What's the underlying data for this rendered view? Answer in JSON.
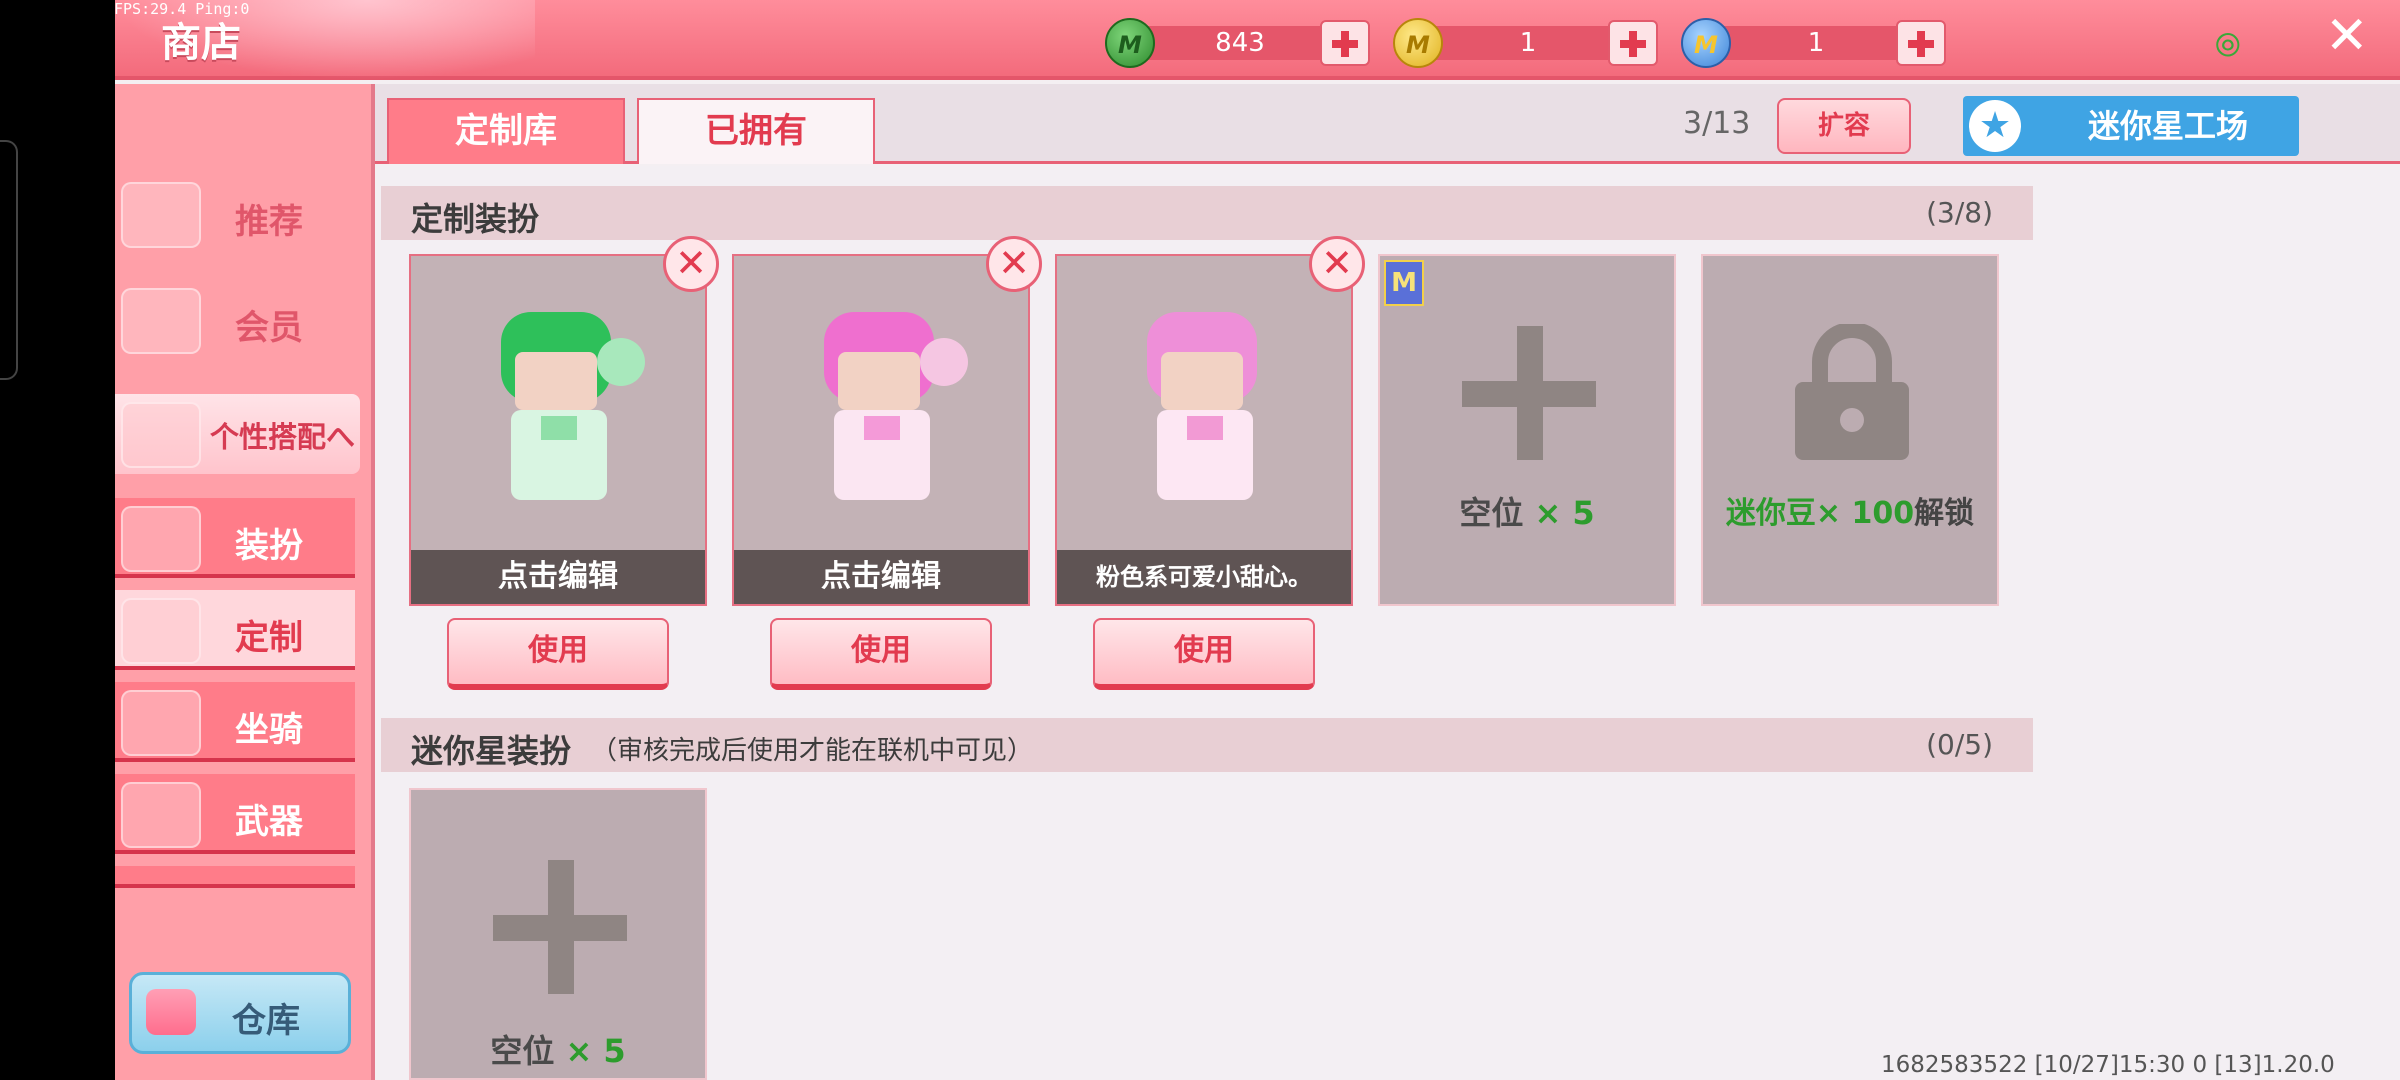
{
  "debug": {
    "fps": "FPS:29.4  Ping:0"
  },
  "header": {
    "title": "商店"
  },
  "currencies": [
    {
      "icon": "green-gem-icon",
      "letter": "M",
      "value": "843",
      "color": "#2e8b2e"
    },
    {
      "icon": "gold-coin-icon",
      "letter": "M",
      "value": "1",
      "color": "#e0b21f"
    },
    {
      "icon": "blue-coin-icon",
      "letter": "M",
      "value": "1",
      "color": "#3d84d8"
    }
  ],
  "nav": {
    "items": [
      {
        "label": "推荐"
      },
      {
        "label": "会员"
      },
      {
        "label": "个性搭配へ"
      },
      {
        "label": "装扮"
      },
      {
        "label": "定制"
      },
      {
        "label": "坐骑"
      },
      {
        "label": "武器"
      }
    ],
    "warehouse": "仓库"
  },
  "tabs": [
    {
      "label": "定制库"
    },
    {
      "label": "已拥有"
    }
  ],
  "capacity": "3/13",
  "expand_label": "扩容",
  "workshop_label": "迷你星工场",
  "section1": {
    "title": "定制装扮",
    "count": "(3/8)"
  },
  "cards": [
    {
      "caption": "点击编辑",
      "use": "使用"
    },
    {
      "caption": "点击编辑",
      "use": "使用"
    },
    {
      "caption": "粉色系可爱小甜心。",
      "use": "使用"
    }
  ],
  "empty_slot": {
    "label": "空位",
    "times": "× 5"
  },
  "locked_slot": {
    "label": "迷你豆",
    "times": "× 100",
    "suffix": "解锁"
  },
  "section2": {
    "title": "迷你星装扮",
    "subtitle": "（审核完成后使用才能在联机中可见）",
    "count": "(0/5)"
  },
  "footer": "1682583522  [10/27]15:30 0  [13]1.20.0"
}
